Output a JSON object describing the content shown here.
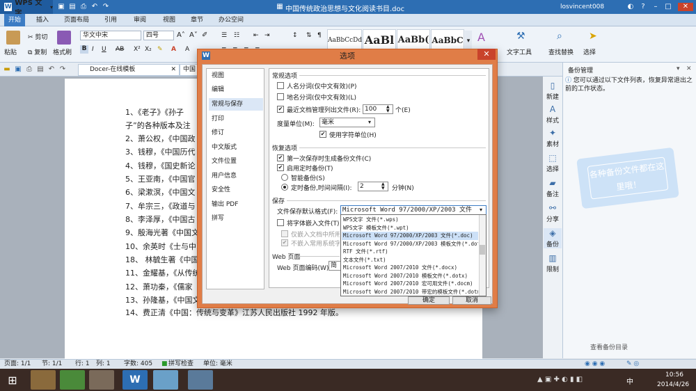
{
  "app": {
    "name": "WPS 文字",
    "doc_title": "中国传统政治思想与文化阅读书目.doc",
    "user": "losvincent008"
  },
  "menu": {
    "tabs": [
      "开始",
      "插入",
      "页面布局",
      "引用",
      "审阅",
      "视图",
      "章节",
      "办公空间"
    ]
  },
  "ribbon": {
    "paste": "粘贴",
    "cut": "剪切",
    "copy": "复制",
    "format_painter": "格式刷",
    "font": "华文中宋",
    "size": "四号",
    "styles": [
      "AaBbCcDd",
      "AaBl",
      "AaBb(",
      "AaBbC"
    ],
    "text_tools": "文字工具",
    "find_replace": "查找替换",
    "select": "选择"
  },
  "docbar": {
    "tab_label": "Docer-在线模板",
    "tab2_label": "中国"
  },
  "document": {
    "lines": [
      "1、《老子》《孙子",
      "子”的各种版本及注",
      "2、萧公权，《中国政",
      "3、钱穆，《中国历代",
      "4、钱穆，《国史新论",
      "5、王亚南，《中国官",
      "6、梁漱溟，《中国文",
      "7、牟宗三，《政道与",
      "8、李泽厚，《中国古",
      "9、殷海光著《中国文",
      "10、余英时《士与中",
      "18、 林毓生著《中国",
      "11、金耀基，《从传统",
      "12、萧功秦，《儒家",
      "13、孙隆基，《中国文",
      "14、费正清《中国：传统与变革》江苏人民出版社  1992 年版。"
    ]
  },
  "sidebar": {
    "buttons": [
      "新建",
      "样式",
      "素材",
      "选择",
      "备注",
      "分享",
      "备份",
      "限制"
    ]
  },
  "backup_panel": {
    "title": "备份管理",
    "info": "您可以通过以下文件列表，恢复异常退出之前的工作状态。",
    "bubble": "各种备份文件都在这里哦！",
    "bottom_label": "查看备份目录"
  },
  "statusbar": {
    "page": "页面: 1/1",
    "section": "节: 1/1",
    "row": "行: 1",
    "col": "列: 1",
    "words": "字数: 405",
    "spell": "拼写检查",
    "unit": "单位: 毫米"
  },
  "taskbar": {
    "ime": "中",
    "time": "10:56",
    "date": "2014/4/26"
  },
  "dialog": {
    "title": "选项",
    "nav": [
      "视图",
      "编辑",
      "常规与保存",
      "打印",
      "修订",
      "中文版式",
      "文件位置",
      "用户信息",
      "安全性",
      "输出 PDF",
      "拼写"
    ],
    "nav_selected_index": 2,
    "general": {
      "section": "常规选项",
      "person_name": "人名分词(仅中文有效)(P)",
      "place_name": "地名分词(仅中文有效)(L)",
      "recent_files": "最近文档管理列出文件(R):",
      "recent_count": "100",
      "recent_unit": "个(E)",
      "measure_label": "度量单位(M):",
      "measure_value": "毫米",
      "char_unit": "使用字符单位(H)"
    },
    "recovery": {
      "section": "恢复选项",
      "first_save_backup": "第一次保存时生成备份文件(C)",
      "timed_backup": "启用定时备份(T)",
      "smart_backup": "智能备份(S)",
      "timed_interval": "定时备份,时间间隔(I):",
      "interval_value": "2",
      "interval_unit": "分钟(N)"
    },
    "save": {
      "section": "保存",
      "default_format_label": "文件保存默认格式(F):",
      "default_format_value": "Microsoft Word 97/2000/XP/2003 文件(*.doc)",
      "embed_fonts": "将字体嵌入文件(T)",
      "embed_used_only": "仅嵌入文档中所用的字符",
      "no_embed_system": "不嵌入常用系统字体"
    },
    "web": {
      "section": "Web 页面",
      "encoding_label": "Web 页面编码(W):",
      "encoding_value": "简体"
    },
    "format_options": [
      "WPS文字 文件(*.wps)",
      "WPS文字 模板文件(*.wpt)",
      "Microsoft Word 97/2000/XP/2003 文件(*.doc)",
      "Microsoft Word 97/2000/XP/2003 模板文件(*.dot)",
      "RTF 文件(*.rtf)",
      "文本文件(*.txt)",
      "Microsoft Word 2007/2010 文件(*.docx)",
      "Microsoft Word 2007/2010 模板文件(*.dotx)",
      "Microsoft Word 2007/2010 宏可用文件(*.docm)",
      "Microsoft Word 2007/2010 带宏的模板文件(*.dotm)"
    ],
    "format_selected_index": 2,
    "ok": "确定",
    "cancel": "取消"
  },
  "colors": {
    "accent": "#2d6eb3",
    "dialog_frame": "#e07d47",
    "close": "#c9432b"
  }
}
